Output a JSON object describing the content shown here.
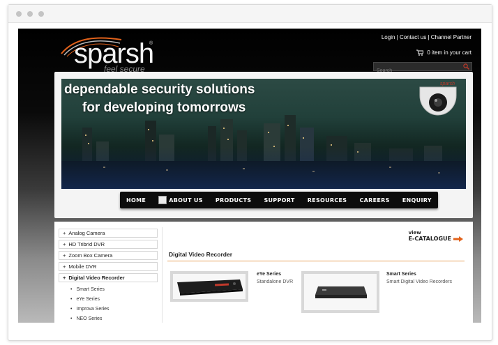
{
  "header": {
    "logo_word": "sparsh",
    "logo_tagline": "feel secure",
    "logo_reg": "®",
    "links": [
      "Login",
      "Contact us",
      "Channel Partner"
    ],
    "link_sep": " | ",
    "cart_text": "0 item in your cart",
    "search_placeholder": "Search"
  },
  "banner": {
    "line1": "dependable security solutions",
    "line2": "for developing tomorrows",
    "camera_brand": "sparsh"
  },
  "nav": {
    "items": [
      "HOME",
      "ABOUT US",
      "PRODUCTS",
      "SUPPORT",
      "RESOURCES",
      "CAREERS",
      "ENQUIRY"
    ]
  },
  "sidebar": {
    "categories": [
      "Analog Camera",
      "HD Tribrid DVR",
      "Zoom Box Camera",
      "Mobile DVR",
      "Digital Video Recorder"
    ],
    "subitems": [
      "Smart Series",
      "eYe Series",
      "Improva Series",
      "NEO Series"
    ]
  },
  "main": {
    "ecatalogue_view": "view",
    "ecatalogue_label": "E-CATALOGUE",
    "section_title": "Digital Video Recorder",
    "products": [
      {
        "name": "eYe Series",
        "desc": "Standalone DVR"
      },
      {
        "name": "Smart Series",
        "desc": "Smart Digital Video Recorders"
      }
    ]
  },
  "colors": {
    "accent_orange": "#e2621b",
    "nav_bg": "#0c0c0c",
    "search_icon": "#c0392b"
  },
  "icons": [
    "cart-icon",
    "search-icon",
    "image-placeholder-icon",
    "plus-icon",
    "arrow-right-icon",
    "bullet-icon"
  ]
}
